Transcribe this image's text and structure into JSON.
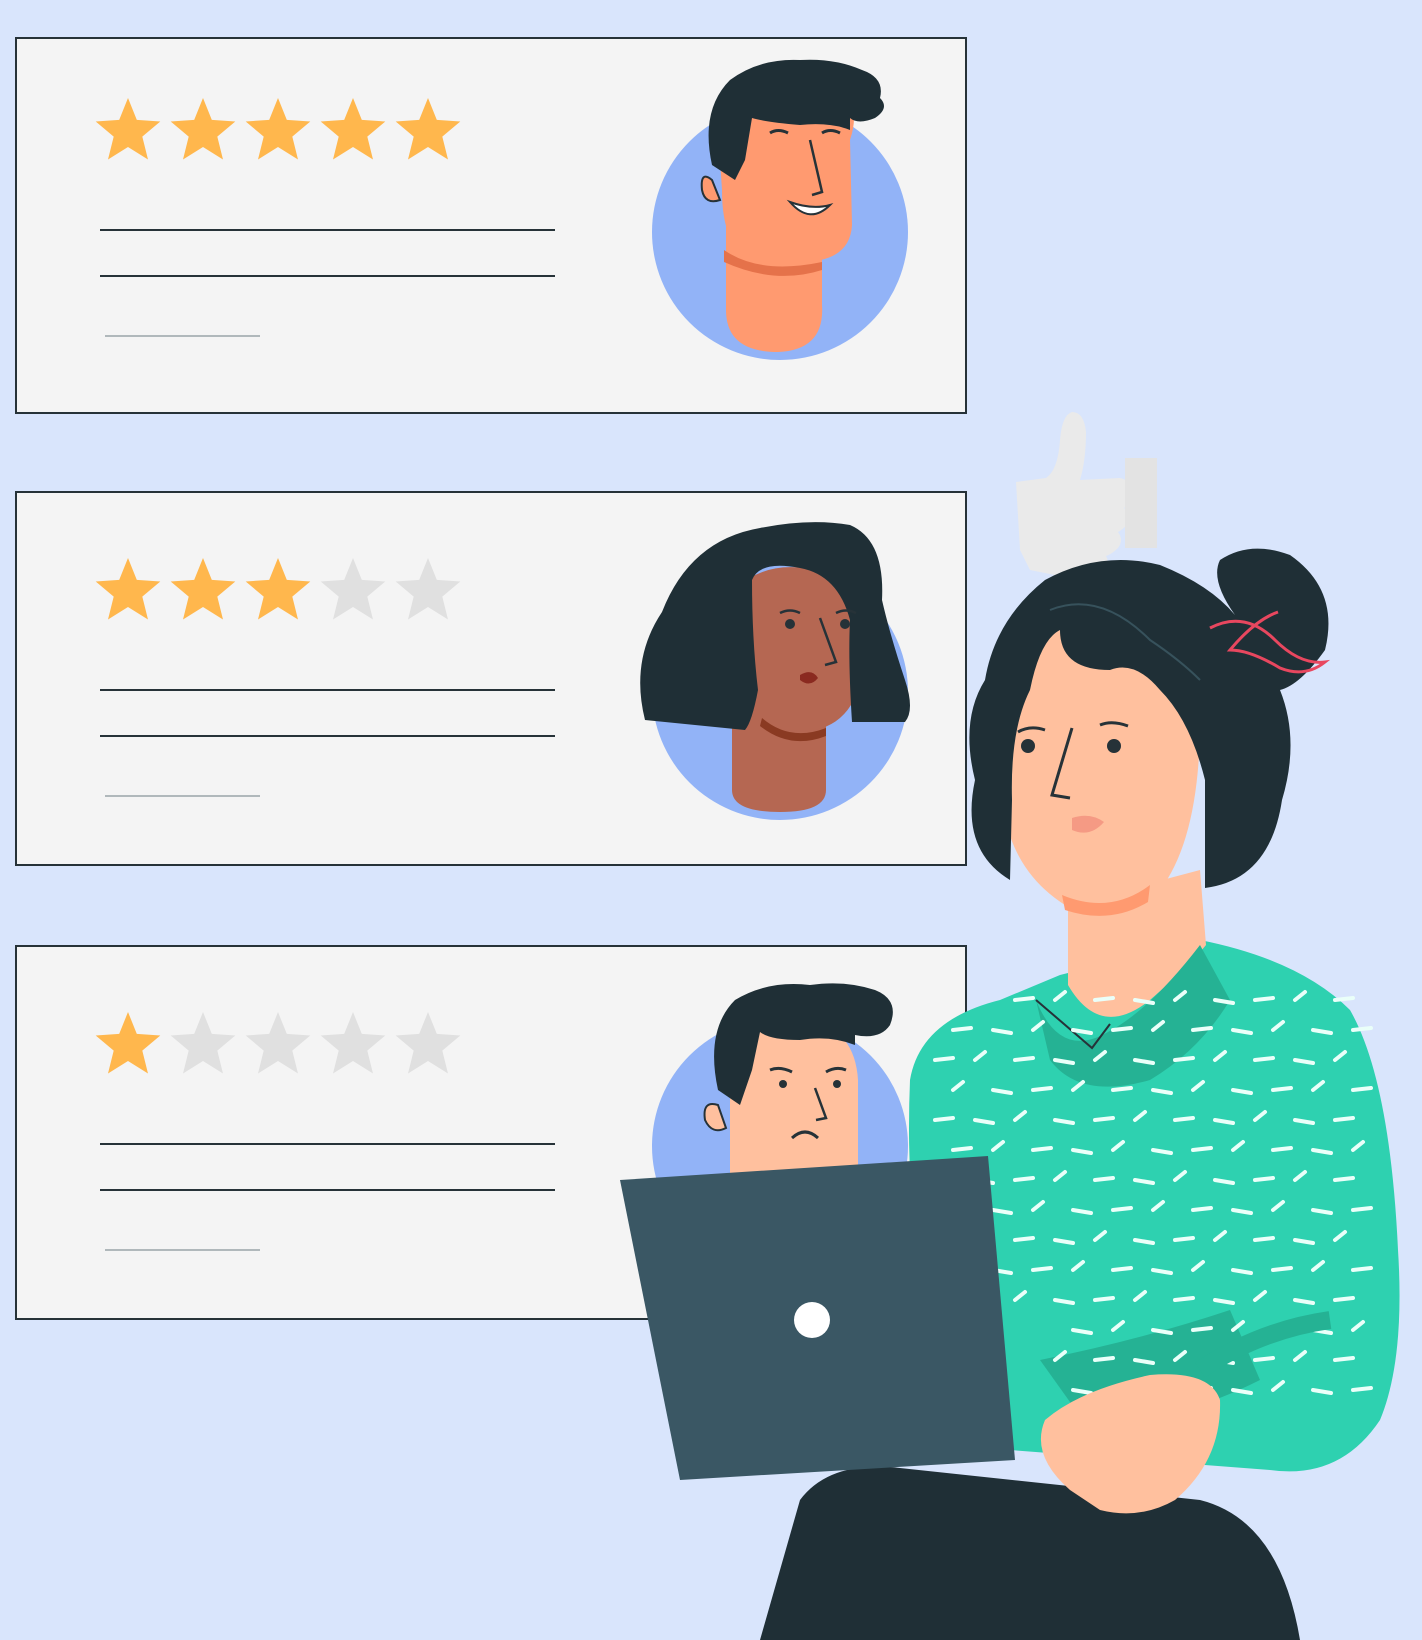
{
  "colors": {
    "background": "#d9e5fc",
    "card": "#f4f4f4",
    "card_border": "#263238",
    "star_filled": "#ffb74d",
    "star_empty": "#e0e0e0",
    "avatar_circle": "#92b3f7",
    "hair": "#1f2f36",
    "shirt": "#2ed1b0",
    "laptop": "#3a5764",
    "skin_light": "#ffc09e",
    "skin_orange": "#ff9a70",
    "skin_brown": "#b56752",
    "thumb": "#eaeaea"
  },
  "reviews": [
    {
      "id": "review-1",
      "rating": 5,
      "max_rating": 5,
      "avatar": "smiling-man-avatar"
    },
    {
      "id": "review-2",
      "rating": 3,
      "max_rating": 5,
      "avatar": "woman-avatar"
    },
    {
      "id": "review-3",
      "rating": 1,
      "max_rating": 5,
      "avatar": "frowning-man-avatar"
    }
  ],
  "icons": [
    "star-icon",
    "thumbs-up-icon",
    "laptop-logo-icon"
  ]
}
